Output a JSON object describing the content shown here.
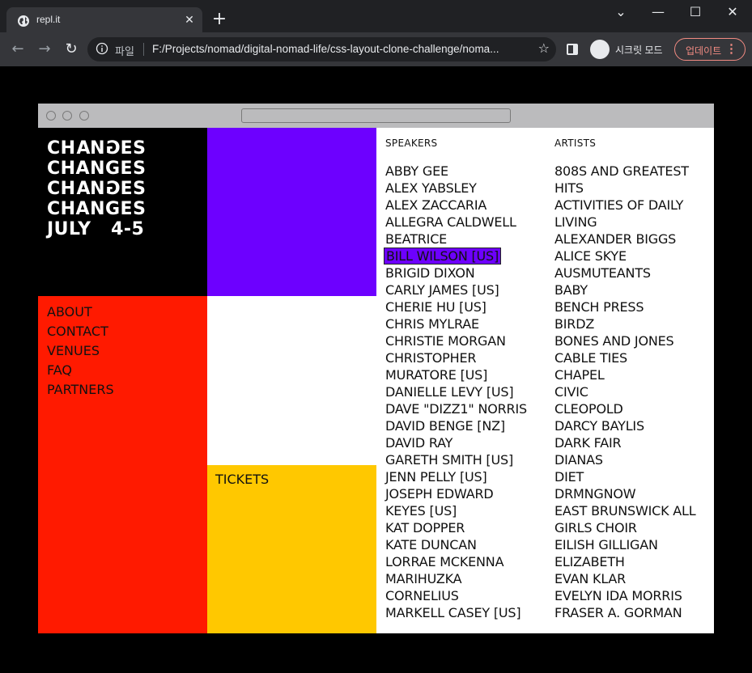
{
  "browser": {
    "tab_title": "repl.it",
    "omnibox_label": "파일",
    "url": "F:/Projects/nomad/digital-nomad-life/css-layout-clone-challenge/noma...",
    "incognito_label": "시크릿 모드",
    "update_label": "업데이트"
  },
  "site": {
    "logo_lines": [
      "CHANGES",
      "CHANGES",
      "CHANGES",
      "CHANGES"
    ],
    "logo_flipped_letter": "G",
    "date": "JULY",
    "date_range": "4-5",
    "menu": [
      "ABOUT",
      "CONTACT",
      "VENUES",
      "FAQ",
      "PARTNERS"
    ],
    "tickets": "TICKETS",
    "speakers_heading": "SPEAKERS",
    "artists_heading": "ARTISTS",
    "speakers": [
      "ABBY GEE",
      "ALEX YABSLEY",
      "ALEX ZACCARIA",
      "ALLEGRA CALDWELL",
      "BEATRICE",
      "BILL WILSON [US]",
      "BRIGID DIXON",
      "CARLY JAMES [US]",
      "CHERIE HU [US]",
      "CHRIS MYLRAE",
      "CHRISTIE MORGAN",
      "CHRISTOPHER",
      "MURATORE [US]",
      "DANIELLE LEVY [US]",
      "DAVE \"DIZZ1\" NORRIS",
      "DAVID BENGE [NZ]",
      "DAVID RAY",
      "GARETH SMITH [US]",
      "JENN PELLY [US]",
      "JOSEPH EDWARD",
      "KEYES [US]",
      "KAT DOPPER",
      "KATE DUNCAN",
      "LORRAE MCKENNA",
      "MARIHUZKA",
      "CORNELIUS",
      "MARKELL CASEY [US]"
    ],
    "artists": [
      "808S AND GREATEST",
      "HITS",
      "ACTIVITIES OF DAILY",
      "LIVING",
      "ALEXANDER BIGGS",
      "ALICE SKYE",
      "AUSMUTEANTS",
      "BABY",
      "BENCH PRESS",
      "BIRDZ",
      "BONES AND JONES",
      "CABLE TIES",
      "CHAPEL",
      "CIVIC",
      "CLEOPOLD",
      "DARCY BAYLIS",
      "DARK FAIR",
      "DIANAS",
      "DIET",
      "DRMNGNOW",
      "EAST BRUNSWICK ALL",
      "GIRLS CHOIR",
      "EILISH GILLIGAN",
      "ELIZABETH",
      "EVAN KLAR",
      "EVELYN IDA MORRIS",
      "FRASER A. GORMAN"
    ],
    "highlighted_speaker_index": 5,
    "colors": {
      "purple": "#6d00ff",
      "red": "#ff1a00",
      "yellow": "#ffc800"
    }
  }
}
